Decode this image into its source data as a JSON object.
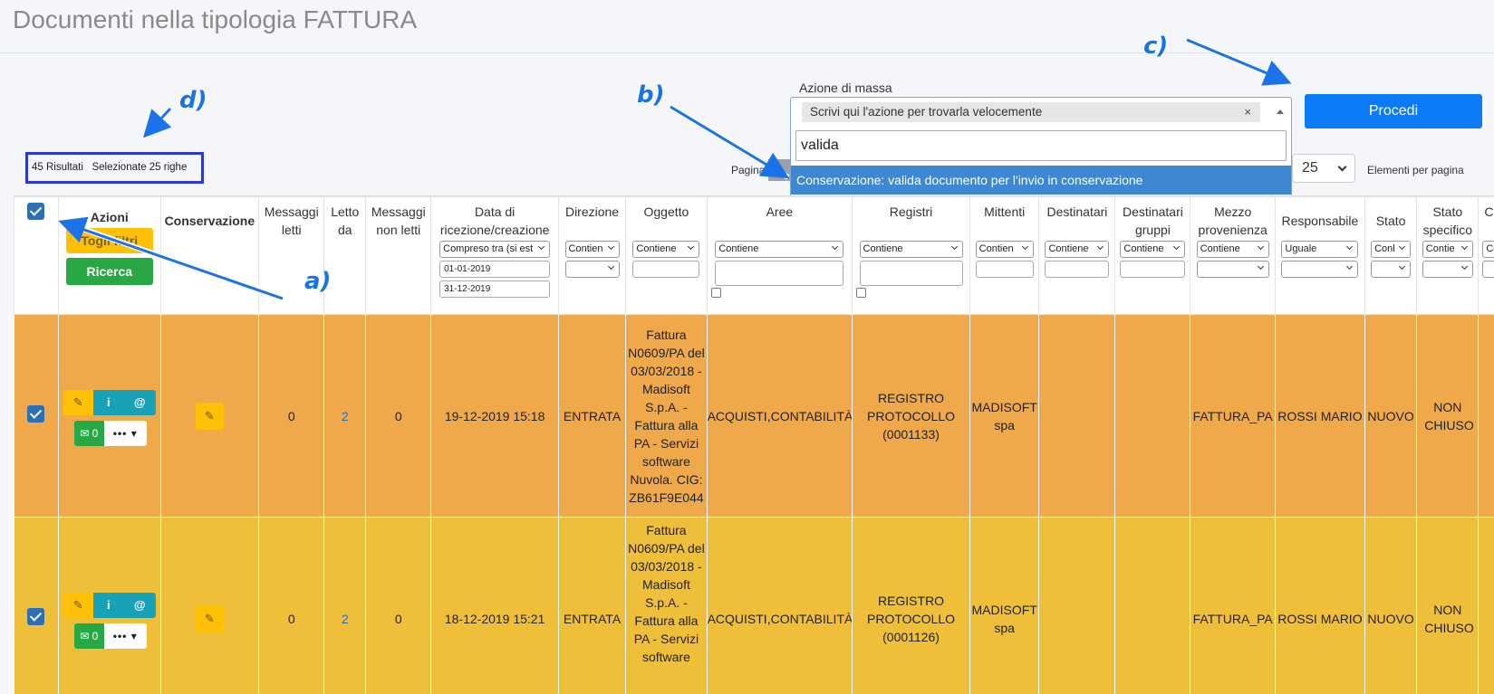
{
  "page_title": "Documenti nella tipologia FATTURA",
  "mass_action": {
    "label": "Azione di massa",
    "placeholder": "Scrivi qui l'azione per trovarla velocemente",
    "clear": "×",
    "search_value": "valida",
    "option": "Conservazione: valida documento per l'invio in conservazione",
    "submit": "Procedi"
  },
  "results": {
    "count": "45 Risultati",
    "selected": "Selezionate 25 righe"
  },
  "pagination": {
    "label": "Pagina",
    "per_page_value": "25",
    "per_page_label": "Elementi per pagina"
  },
  "annotations": {
    "a": "a)",
    "b": "b)",
    "c": "c)",
    "d": "d)"
  },
  "columns": {
    "azioni": "Azioni",
    "conservazione": "Conservazione",
    "messaggi_letti": "Messaggi letti",
    "letto_da": "Letto da",
    "messaggi_non_letti": "Messaggi non letti",
    "data": "Data di ricezione/creazione",
    "direzione": "Direzione",
    "oggetto": "Oggetto",
    "aree": "Aree",
    "registri": "Registri",
    "mittenti": "Mittenti",
    "destinatari": "Destinatari",
    "destinatari_gruppi": "Destinatari gruppi",
    "mezzo": "Mezzo provenienza",
    "responsabile": "Responsabile",
    "stato": "Stato",
    "stato_specifico": "Stato specifico",
    "extra": "C pro"
  },
  "filters": {
    "togli_filtri": "Togli filtri",
    "ricerca": "Ricerca",
    "data_mode": "Compreso tra (si est",
    "data_from": "01-01-2019",
    "data_to": "31-12-2019",
    "contien": "Contien",
    "contiene": "Contiene",
    "uguale": "Uguale",
    "conl": "Conl",
    "contie": "Contie",
    "con": "Con"
  },
  "action_icons": {
    "edit": "edit-icon",
    "info": "info-icon",
    "at": "at-icon",
    "mail": "envelope-icon",
    "more": "more-icon"
  },
  "rows": [
    {
      "color": "#f0a94a",
      "mail_count": "0",
      "messaggi_letti": "0",
      "letto_da": "2",
      "messaggi_non_letti": "0",
      "data": "19-12-2019 15:18",
      "direzione": "ENTRATA",
      "oggetto": "Fattura N0609/PA del 03/03/2018 - Madisoft S.p.A. - Fattura alla PA - Servizi software Nuvola. CIG: ZB61F9E044",
      "aree": "ACQUISTI,CONTABILITÀ",
      "registri": "REGISTRO PROTOCOLLO (0001133)",
      "mittenti": "MADISOFT spa",
      "destinatari": "",
      "destinatari_gruppi": "",
      "mezzo": "FATTURA_PA",
      "responsabile": "ROSSI MARIO",
      "stato": "NUOVO",
      "stato_specifico": "NON CHIUSO"
    },
    {
      "color": "#f0bf3a",
      "mail_count": "0",
      "messaggi_letti": "0",
      "letto_da": "2",
      "messaggi_non_letti": "0",
      "data": "18-12-2019 15:21",
      "direzione": "ENTRATA",
      "oggetto": "Fattura N0609/PA del 03/03/2018 - Madisoft S.p.A. - Fattura alla PA - Servizi software",
      "aree": "ACQUISTI,CONTABILITÀ",
      "registri": "REGISTRO PROTOCOLLO (0001126)",
      "mittenti": "MADISOFT spa",
      "destinatari": "",
      "destinatari_gruppi": "",
      "mezzo": "FATTURA_PA",
      "responsabile": "ROSSI MARIO",
      "stato": "NUOVO",
      "stato_specifico": "NON CHIUSO"
    }
  ]
}
